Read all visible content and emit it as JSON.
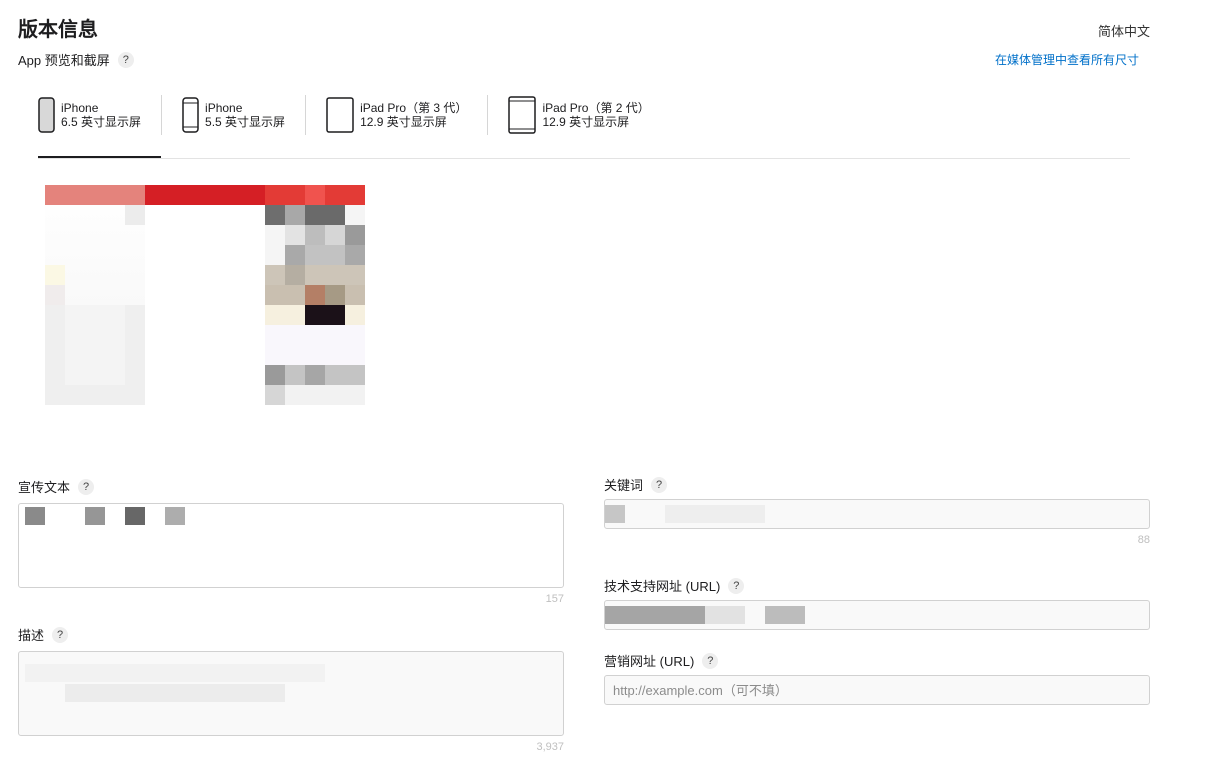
{
  "header": {
    "title": "版本信息",
    "language": "简体中文"
  },
  "preview": {
    "label": "App 预览和截屏",
    "help": "?",
    "media_link": "在媒体管理中查看所有尺寸",
    "tabs": [
      {
        "line1": "iPhone",
        "line2": "6.5 英寸显示屏",
        "active": true
      },
      {
        "line1": "iPhone",
        "line2": "5.5 英寸显示屏",
        "active": false
      },
      {
        "line1": "iPad Pro（第 3 代）",
        "line2": "12.9 英寸显示屏",
        "active": false
      },
      {
        "line1": "iPad Pro（第 2 代）",
        "line2": "12.9 英寸显示屏",
        "active": false
      }
    ],
    "tab_icons": [
      "iphone-6-5-icon",
      "iphone-5-5-icon",
      "ipad-pro-3-icon",
      "ipad-pro-2-icon"
    ]
  },
  "fields": {
    "promo_text": {
      "label": "宣传文本",
      "help": "?",
      "counter": "157"
    },
    "description": {
      "label": "描述",
      "help": "?",
      "counter": "3,937"
    },
    "keywords": {
      "label": "关键词",
      "help": "?",
      "counter": "88"
    },
    "support_url": {
      "label": "技术支持网址 (URL)",
      "help": "?"
    },
    "marketing_url": {
      "label": "营销网址 (URL)",
      "help": "?",
      "placeholder": "http://example.com（可不填）",
      "value": ""
    }
  },
  "colors": {
    "accent_link": "#0070c9",
    "screenshot_banner": "#d51f25"
  }
}
